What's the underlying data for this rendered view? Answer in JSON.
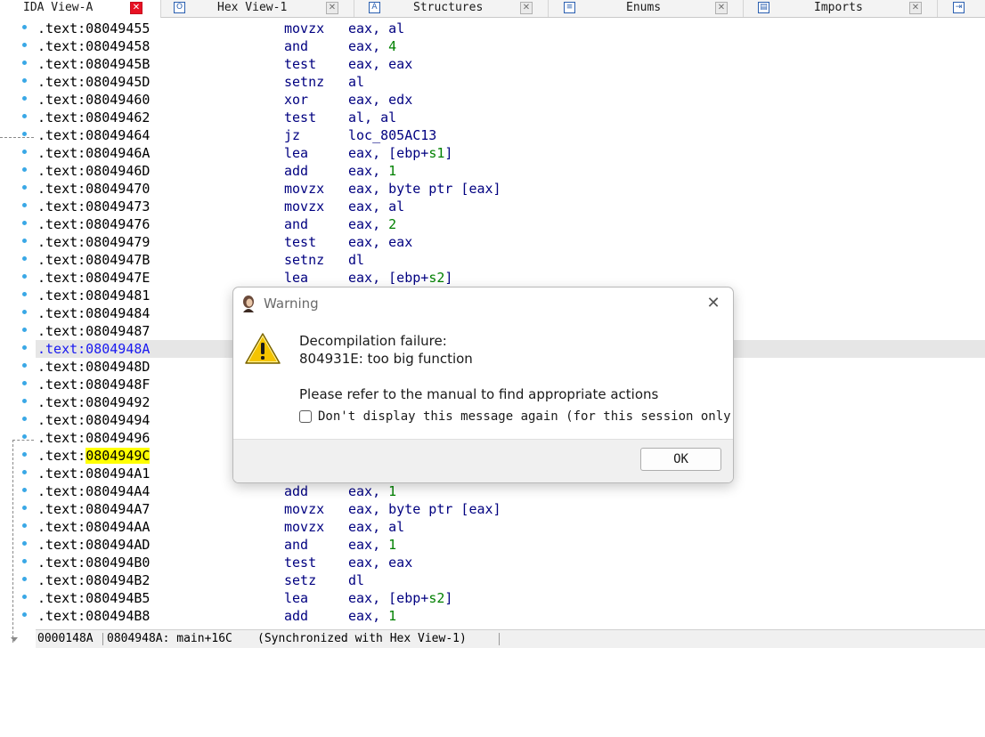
{
  "tabs": [
    {
      "label": "IDA View-A",
      "icon": "ida-view-icon",
      "close": "✕"
    },
    {
      "label": "Hex View-1",
      "icon": "hex-view-icon",
      "icon_glyph": "O",
      "close": "✕"
    },
    {
      "label": "Structures",
      "icon": "structures-icon",
      "icon_glyph": "A",
      "close": "✕"
    },
    {
      "label": "Enums",
      "icon": "enums-icon",
      "icon_glyph": "≡",
      "close": "✕"
    },
    {
      "label": "Imports",
      "icon": "imports-icon",
      "icon_glyph": "▤",
      "close": "✕"
    },
    {
      "label": "",
      "icon": "exports-icon",
      "icon_glyph": "⇥"
    }
  ],
  "listing": [
    {
      "addr": ".text:08049455",
      "mn": "movzx",
      "ops": "eax, al"
    },
    {
      "addr": ".text:08049458",
      "mn": "and",
      "ops": "eax, ",
      "num": "4"
    },
    {
      "addr": ".text:0804945B",
      "mn": "test",
      "ops": "eax, eax"
    },
    {
      "addr": ".text:0804945D",
      "mn": "setnz",
      "ops": "al"
    },
    {
      "addr": ".text:08049460",
      "mn": "xor",
      "ops": "eax, edx"
    },
    {
      "addr": ".text:08049462",
      "mn": "test",
      "ops": "al, al"
    },
    {
      "addr": ".text:08049464",
      "mn": "jz",
      "ops": "loc_805AC13"
    },
    {
      "addr": ".text:0804946A",
      "mn": "lea",
      "ops": "eax, [ebp+",
      "num": "s1",
      "tail": "]"
    },
    {
      "addr": ".text:0804946D",
      "mn": "add",
      "ops": "eax, ",
      "num": "1"
    },
    {
      "addr": ".text:08049470",
      "mn": "movzx",
      "ops": "eax, byte ptr [eax]"
    },
    {
      "addr": ".text:08049473",
      "mn": "movzx",
      "ops": "eax, al"
    },
    {
      "addr": ".text:08049476",
      "mn": "and",
      "ops": "eax, ",
      "num": "2"
    },
    {
      "addr": ".text:08049479",
      "mn": "test",
      "ops": "eax, eax"
    },
    {
      "addr": ".text:0804947B",
      "mn": "setnz",
      "ops": "dl"
    },
    {
      "addr": ".text:0804947E",
      "mn": "lea",
      "ops": "eax, [ebp+",
      "num": "s2",
      "tail": "]"
    },
    {
      "addr": ".text:08049481",
      "mn": "",
      "ops": ""
    },
    {
      "addr": ".text:08049484",
      "mn": "",
      "ops": ""
    },
    {
      "addr": ".text:08049487",
      "mn": "",
      "ops": ""
    },
    {
      "addr": ".text:0804948A",
      "mn": "",
      "ops": "",
      "selected": true
    },
    {
      "addr": ".text:0804948D",
      "mn": "",
      "ops": ""
    },
    {
      "addr": ".text:0804948F",
      "mn": "",
      "ops": ""
    },
    {
      "addr": ".text:08049492",
      "mn": "",
      "ops": ""
    },
    {
      "addr": ".text:08049494",
      "mn": "",
      "ops": ""
    },
    {
      "addr": ".text:08049496",
      "mn": "",
      "ops": ""
    },
    {
      "addr": ".text:",
      "addr_hl": "0804949C",
      "mn": "",
      "ops": ""
    },
    {
      "addr": ".text:080494A1",
      "mn": "",
      "ops": ""
    },
    {
      "addr": ".text:080494A4",
      "mn": "add",
      "ops": "eax, ",
      "num": "1"
    },
    {
      "addr": ".text:080494A7",
      "mn": "movzx",
      "ops": "eax, byte ptr [eax]"
    },
    {
      "addr": ".text:080494AA",
      "mn": "movzx",
      "ops": "eax, al"
    },
    {
      "addr": ".text:080494AD",
      "mn": "and",
      "ops": "eax, ",
      "num": "1"
    },
    {
      "addr": ".text:080494B0",
      "mn": "test",
      "ops": "eax, eax"
    },
    {
      "addr": ".text:080494B2",
      "mn": "setz",
      "ops": "dl"
    },
    {
      "addr": ".text:080494B5",
      "mn": "lea",
      "ops": "eax, [ebp+",
      "num": "s2",
      "tail": "]"
    },
    {
      "addr": ".text:080494B8",
      "mn": "add",
      "ops": "eax, ",
      "num": "1"
    }
  ],
  "status": {
    "offset": "0000148A",
    "location": "0804948A: main+16C",
    "sync": "(Synchronized with Hex View-1)"
  },
  "dialog": {
    "title": "Warning",
    "close": "✕",
    "line1": "Decompilation failure:",
    "line2": "804931E: too big function",
    "line3": "Please refer to the manual to find appropriate actions",
    "checkbox_label": "Don't display this message again (for this session only)",
    "checkbox_checked": false,
    "ok_label": "OK"
  },
  "colors": {
    "mnemonic": "#000080",
    "number": "#008000",
    "selected_addr": "#1a1af0",
    "highlight": "#ffff00",
    "gutter_dot": "#3aa8e6"
  }
}
